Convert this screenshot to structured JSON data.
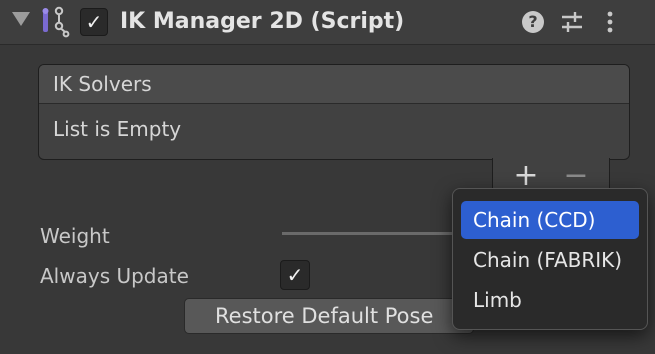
{
  "component": {
    "title": "IK Manager 2D (Script)",
    "enabled_check": "✓",
    "help_glyph": "?"
  },
  "ik_solvers": {
    "header": "IK Solvers",
    "empty_text": "List is Empty",
    "add_glyph": "+",
    "remove_glyph": "−"
  },
  "fields": {
    "weight_label": "Weight",
    "always_update_label": "Always Update",
    "always_update_check": "✓",
    "restore_label": "Restore Default Pose"
  },
  "menu": {
    "items": [
      {
        "label": "Chain (CCD)"
      },
      {
        "label": "Chain (FABRIK)"
      },
      {
        "label": "Limb"
      }
    ],
    "selected_color": "#2d5fd0"
  }
}
